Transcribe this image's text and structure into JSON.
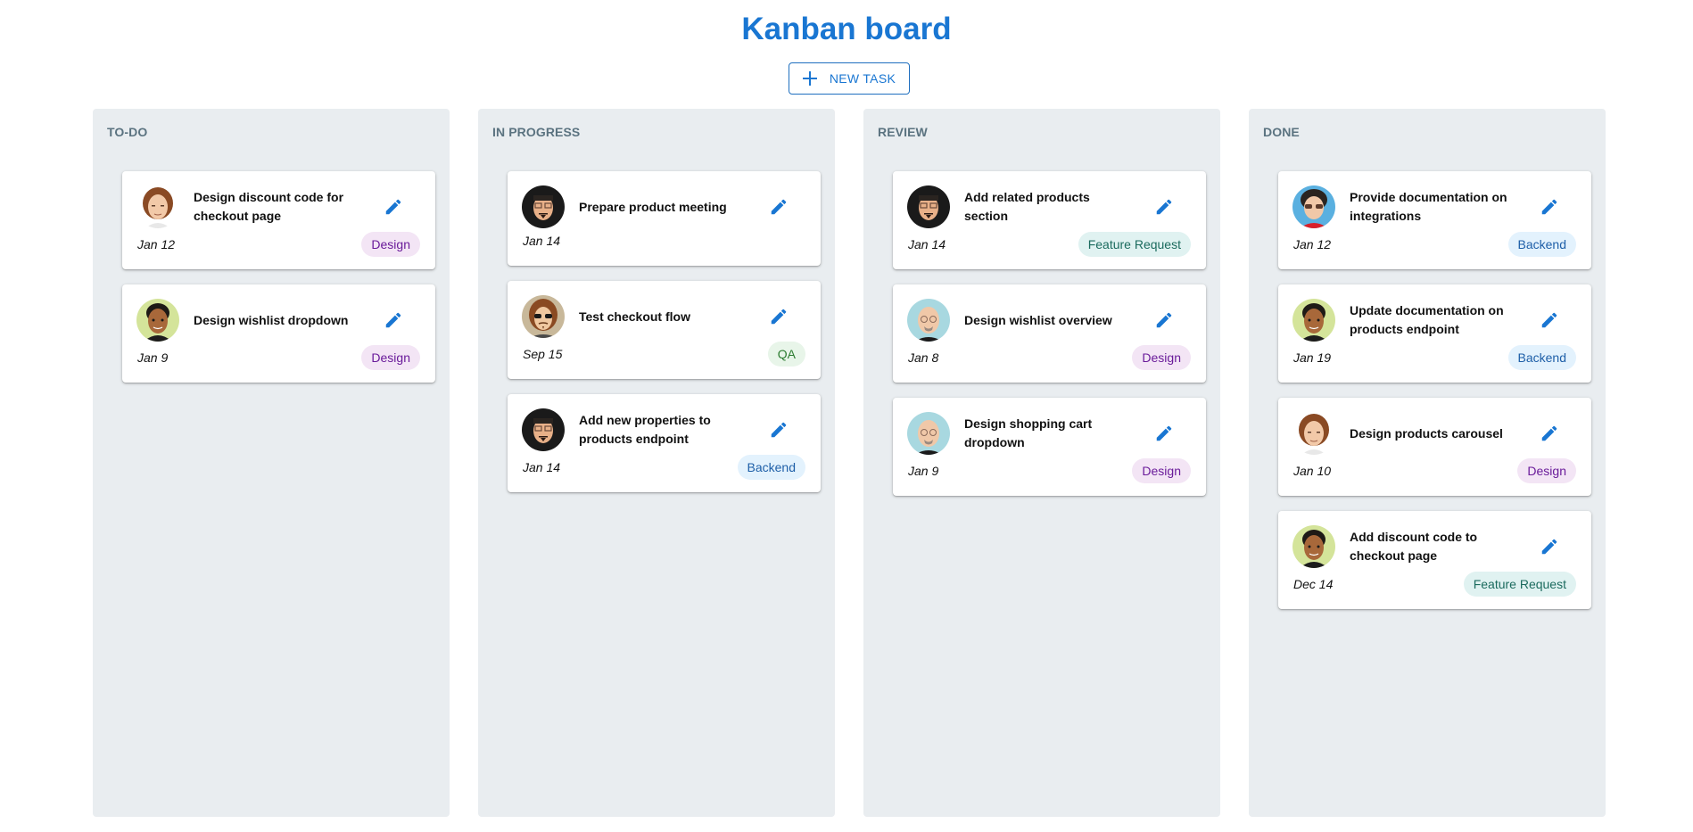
{
  "header": {
    "title": "Kanban board",
    "new_task_label": "NEW TASK",
    "new_task_icon": "plus-icon"
  },
  "colors": {
    "accent": "#1976d2",
    "column_bg": "#e9edf0",
    "tag_design": "#f3e5f5",
    "tag_backend": "#e3f2fd",
    "tag_qa": "#e8f5e9",
    "tag_feature_request": "#e0f2f1"
  },
  "columns": [
    {
      "title": "TO-DO",
      "cards": [
        {
          "title": "Design discount code for checkout page",
          "date": "Jan 12",
          "tag": "Design",
          "avatar": "avatar-brown-hair"
        },
        {
          "title": "Design wishlist dropdown",
          "date": "Jan 9",
          "tag": "Design",
          "avatar": "avatar-dark-skin"
        }
      ]
    },
    {
      "title": "IN PROGRESS",
      "cards": [
        {
          "title": "Prepare product meeting",
          "date": "Jan 14",
          "tag": null,
          "avatar": "avatar-glasses-goatee"
        },
        {
          "title": "Test checkout flow",
          "date": "Sep 15",
          "tag": "QA",
          "avatar": "avatar-sunglasses-longhair"
        },
        {
          "title": "Add new properties to products endpoint",
          "date": "Jan 14",
          "tag": "Backend",
          "avatar": "avatar-glasses-goatee"
        }
      ]
    },
    {
      "title": "REVIEW",
      "cards": [
        {
          "title": "Add related products section",
          "date": "Jan 14",
          "tag": "Feature Request",
          "avatar": "avatar-glasses-goatee"
        },
        {
          "title": "Design wishlist overview",
          "date": "Jan 8",
          "tag": "Design",
          "avatar": "avatar-bald-glasses"
        },
        {
          "title": "Design shopping cart dropdown",
          "date": "Jan 9",
          "tag": "Design",
          "avatar": "avatar-bald-glasses"
        }
      ]
    },
    {
      "title": "DONE",
      "cards": [
        {
          "title": "Provide documentation on integrations",
          "date": "Jan 12",
          "tag": "Backend",
          "avatar": "avatar-sunglasses-red"
        },
        {
          "title": "Update documentation on products endpoint",
          "date": "Jan 19",
          "tag": "Backend",
          "avatar": "avatar-dark-skin"
        },
        {
          "title": "Design products carousel",
          "date": "Jan 10",
          "tag": "Design",
          "avatar": "avatar-brown-hair"
        },
        {
          "title": "Add discount code to checkout page",
          "date": "Dec 14",
          "tag": "Feature Request",
          "avatar": "avatar-dark-skin"
        }
      ]
    }
  ]
}
